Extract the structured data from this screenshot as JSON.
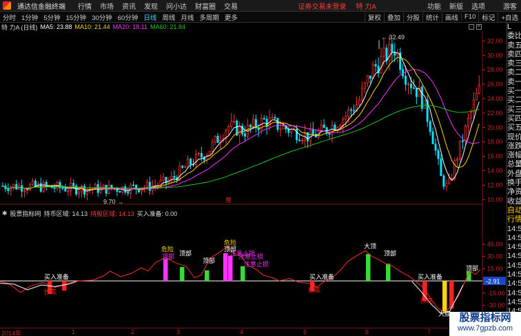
{
  "titlebar": {
    "app_name": "通达信金融终端",
    "menus": [
      "行情",
      "市场",
      "资讯",
      "发现",
      "问小达",
      "财富圈",
      "交易"
    ],
    "warning": "证券交易未登录",
    "stock": "特 力A",
    "right": [
      "功能",
      "新版",
      "选项",
      "游客"
    ]
  },
  "toolbar": {
    "periods": [
      "分时",
      "1分钟",
      "5分钟",
      "15分钟",
      "30分钟",
      "60分钟",
      "日线",
      "周线",
      "月线",
      "多周期",
      "更多"
    ],
    "active_period": "日线",
    "tools": [
      "叠加",
      "分股",
      "统计",
      "画线",
      "F10",
      "标记",
      "+自选"
    ],
    "first_tool_partial": "复权"
  },
  "info": {
    "name": "特 力A (日线)",
    "ma5": "MA5: 23.88",
    "ma10": "MA10: 21.44",
    "ma20": "MA20: 18.11",
    "ma60": "MA60: 21.84"
  },
  "price_axis": [
    "32.00",
    "30.00",
    "28.00",
    "26.00",
    "24.00",
    "22.00",
    "20.00",
    "18.00",
    "16.00",
    "14.00",
    "12.00",
    "10.00"
  ],
  "price_annotations": {
    "high": "32.49",
    "low": "9.70",
    "mid_label": "庵"
  },
  "indicator": {
    "title": "股票指标网",
    "line1": "持币区域: 14.13",
    "line2": "持股区域: 14.13",
    "line3": "买入准备: 0.00",
    "axis": [
      "45.00",
      "30.00",
      "15.00",
      "-15.00",
      "-30.00"
    ],
    "current": "-2.91",
    "labels": {
      "prep": "买入准备",
      "bottom": "抄底",
      "warn": "危险",
      "top": "顶部",
      "stop": "注意止损",
      "high": "大顶",
      "deep": "大底"
    }
  },
  "xaxis": [
    "2014年",
    "1",
    "2",
    "3",
    "4",
    "5",
    "6",
    "7"
  ],
  "right_panel": [
    "L",
    "委比",
    "卖五",
    "卖四",
    "卖三",
    "卖二",
    "卖一",
    "买一",
    "买二",
    "买三",
    "买四",
    "买五",
    "现价",
    "涨跌",
    "涨幅",
    "总量",
    "外盘",
    "换手",
    "净资",
    "收益",
    "自动",
    "行情",
    "14:5",
    "14:5",
    "14:5",
    "14:5",
    "14:5",
    "14:5",
    "14:5",
    "14:5",
    "14:5",
    "14:5",
    "14:5"
  ],
  "watermark": {
    "title": "股票指标网",
    "url": "www.7gpzb.com"
  },
  "colors": {
    "up": "#ff3030",
    "down": "#00e5ff",
    "ma5": "#ffffff",
    "ma10": "#ffd400",
    "ma20": "#ff33ff",
    "ma60": "#21c521",
    "axis": "#c62828"
  }
}
